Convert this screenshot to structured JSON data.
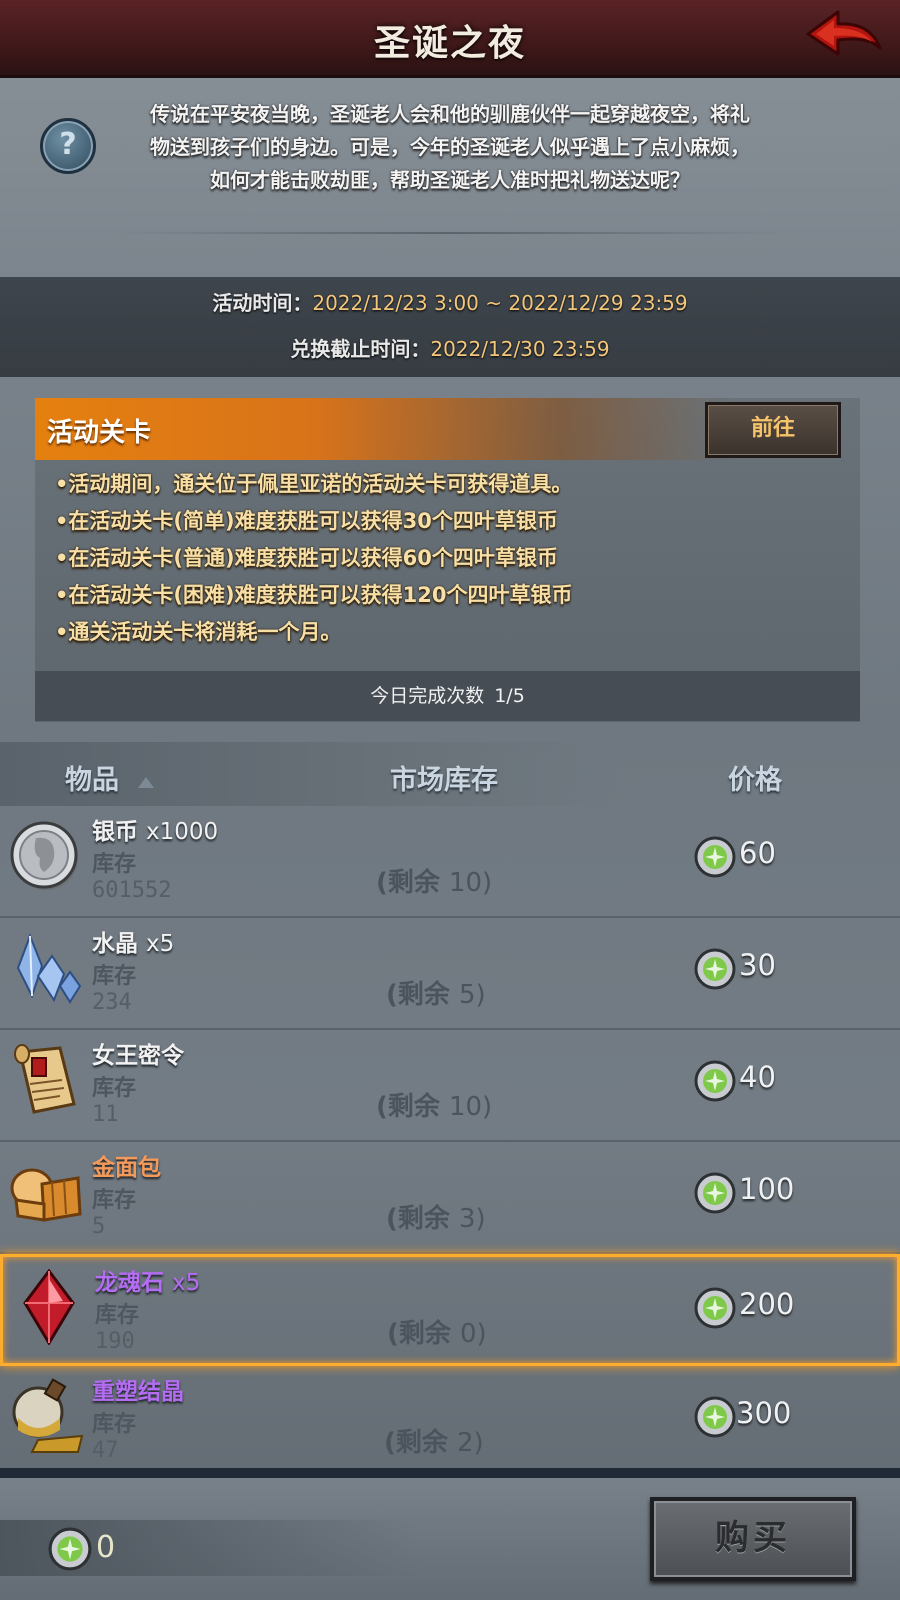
{
  "header": {
    "title": "圣诞之夜",
    "back_icon": "back-arrow-icon"
  },
  "intro": {
    "lines": [
      "传说在平安夜当晚，圣诞老人会和他的驯鹿伙伴一起穿越夜空，将礼",
      "物送到孩子们的身边。可是，今年的圣诞老人似乎遇上了点小麻烦，",
      "如何才能击败劫匪，帮助圣诞老人准时把礼物送达呢？"
    ],
    "help_icon": "?"
  },
  "times": {
    "activity_label": "活动时间：",
    "activity_value": "2022/12/23 3:00 ~ 2022/12/29 23:59",
    "exchange_label": "兑换截止时间：",
    "exchange_value": "2022/12/30 23:59"
  },
  "activity": {
    "title": "活动关卡",
    "go_label": "前往",
    "lines": [
      "•活动期间，通关位于佩里亚诺的活动关卡可获得道具。",
      "•在活动关卡(简单)难度获胜可以获得30个四叶草银币",
      "•在活动关卡(普通)难度获胜可以获得60个四叶草银币",
      "•在活动关卡(困难)难度获胜可以获得120个四叶草银币",
      "•通关活动关卡将消耗一个月。"
    ],
    "count_label": "今日完成次数",
    "count_value": "1/5"
  },
  "table": {
    "col_item": "物品",
    "col_stock": "市场库存",
    "col_price": "价格"
  },
  "items": [
    {
      "name": "银币",
      "qty": "x1000",
      "stock_label": "库存",
      "stock": "601552",
      "remain_open": "(剩余",
      "remain": "10)",
      "price": "60",
      "name_color": "#f2f2f2",
      "icon": "silver-coin-icon"
    },
    {
      "name": "水晶",
      "qty": "x5",
      "stock_label": "库存",
      "stock": "234",
      "remain_open": "(剩余",
      "remain": "5)",
      "price": "30",
      "name_color": "#f2f2f2",
      "icon": "crystal-icon"
    },
    {
      "name": "女王密令",
      "qty": "",
      "stock_label": "库存",
      "stock": "11",
      "remain_open": "(剩余",
      "remain": "10)",
      "price": "40",
      "name_color": "#f2f2f2",
      "icon": "scroll-icon"
    },
    {
      "name": "金面包",
      "qty": "",
      "stock_label": "库存",
      "stock": "5",
      "remain_open": "(剩余",
      "remain": "3)",
      "price": "100",
      "name_color": "#f39a5a",
      "icon": "bread-icon"
    },
    {
      "name": "龙魂石",
      "qty": "x5",
      "stock_label": "库存",
      "stock": "190",
      "remain_open": "(剩余",
      "remain": "0)",
      "price": "200",
      "name_color": "#b46cf2",
      "icon": "dragon-soul-stone-icon"
    },
    {
      "name": "重塑结晶",
      "qty": "",
      "stock_label": "库存",
      "stock": "47",
      "remain_open": "(剩余",
      "remain": "2)",
      "price": "300",
      "name_color": "#b46cf2",
      "icon": "reshape-crystal-icon"
    }
  ],
  "footer": {
    "balance": "0",
    "buy_label": "购买",
    "currency_icon": "clover-silver-coin-icon"
  },
  "colors": {
    "header": "#4a1c1e",
    "accent_orange": "#e5800f",
    "selected_border": "#ffad2e",
    "time_value": "#f4c77a"
  }
}
